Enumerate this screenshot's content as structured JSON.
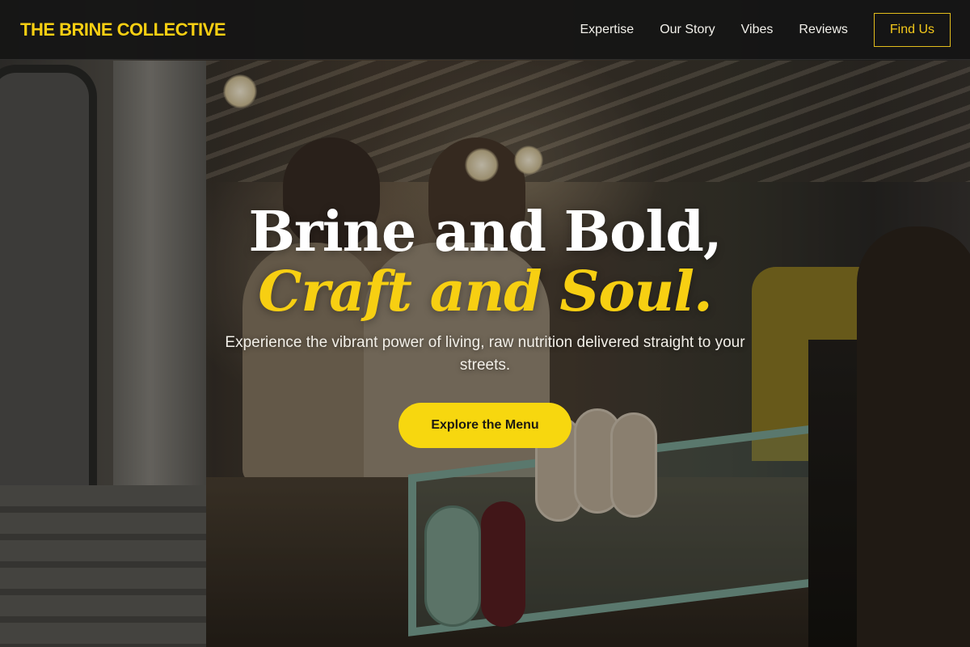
{
  "brand": {
    "name": "THE BRINE COLLECTIVE"
  },
  "nav": {
    "items": [
      {
        "label": "Expertise"
      },
      {
        "label": "Our Story"
      },
      {
        "label": "Vibes"
      },
      {
        "label": "Reviews"
      }
    ],
    "cta_label": "Find Us"
  },
  "hero": {
    "headline_line1": "Brine and Bold,",
    "headline_line2": "Craft and Soul.",
    "subtitle": "Experience the vibrant power of living, raw nutrition delivered straight to your streets.",
    "cta_label": "Explore the Menu",
    "background_image": "food truck with two women serving a customer"
  },
  "colors": {
    "accent": "#f7cf12",
    "nav_background": "#141414",
    "cta_background": "#f7d70f"
  }
}
